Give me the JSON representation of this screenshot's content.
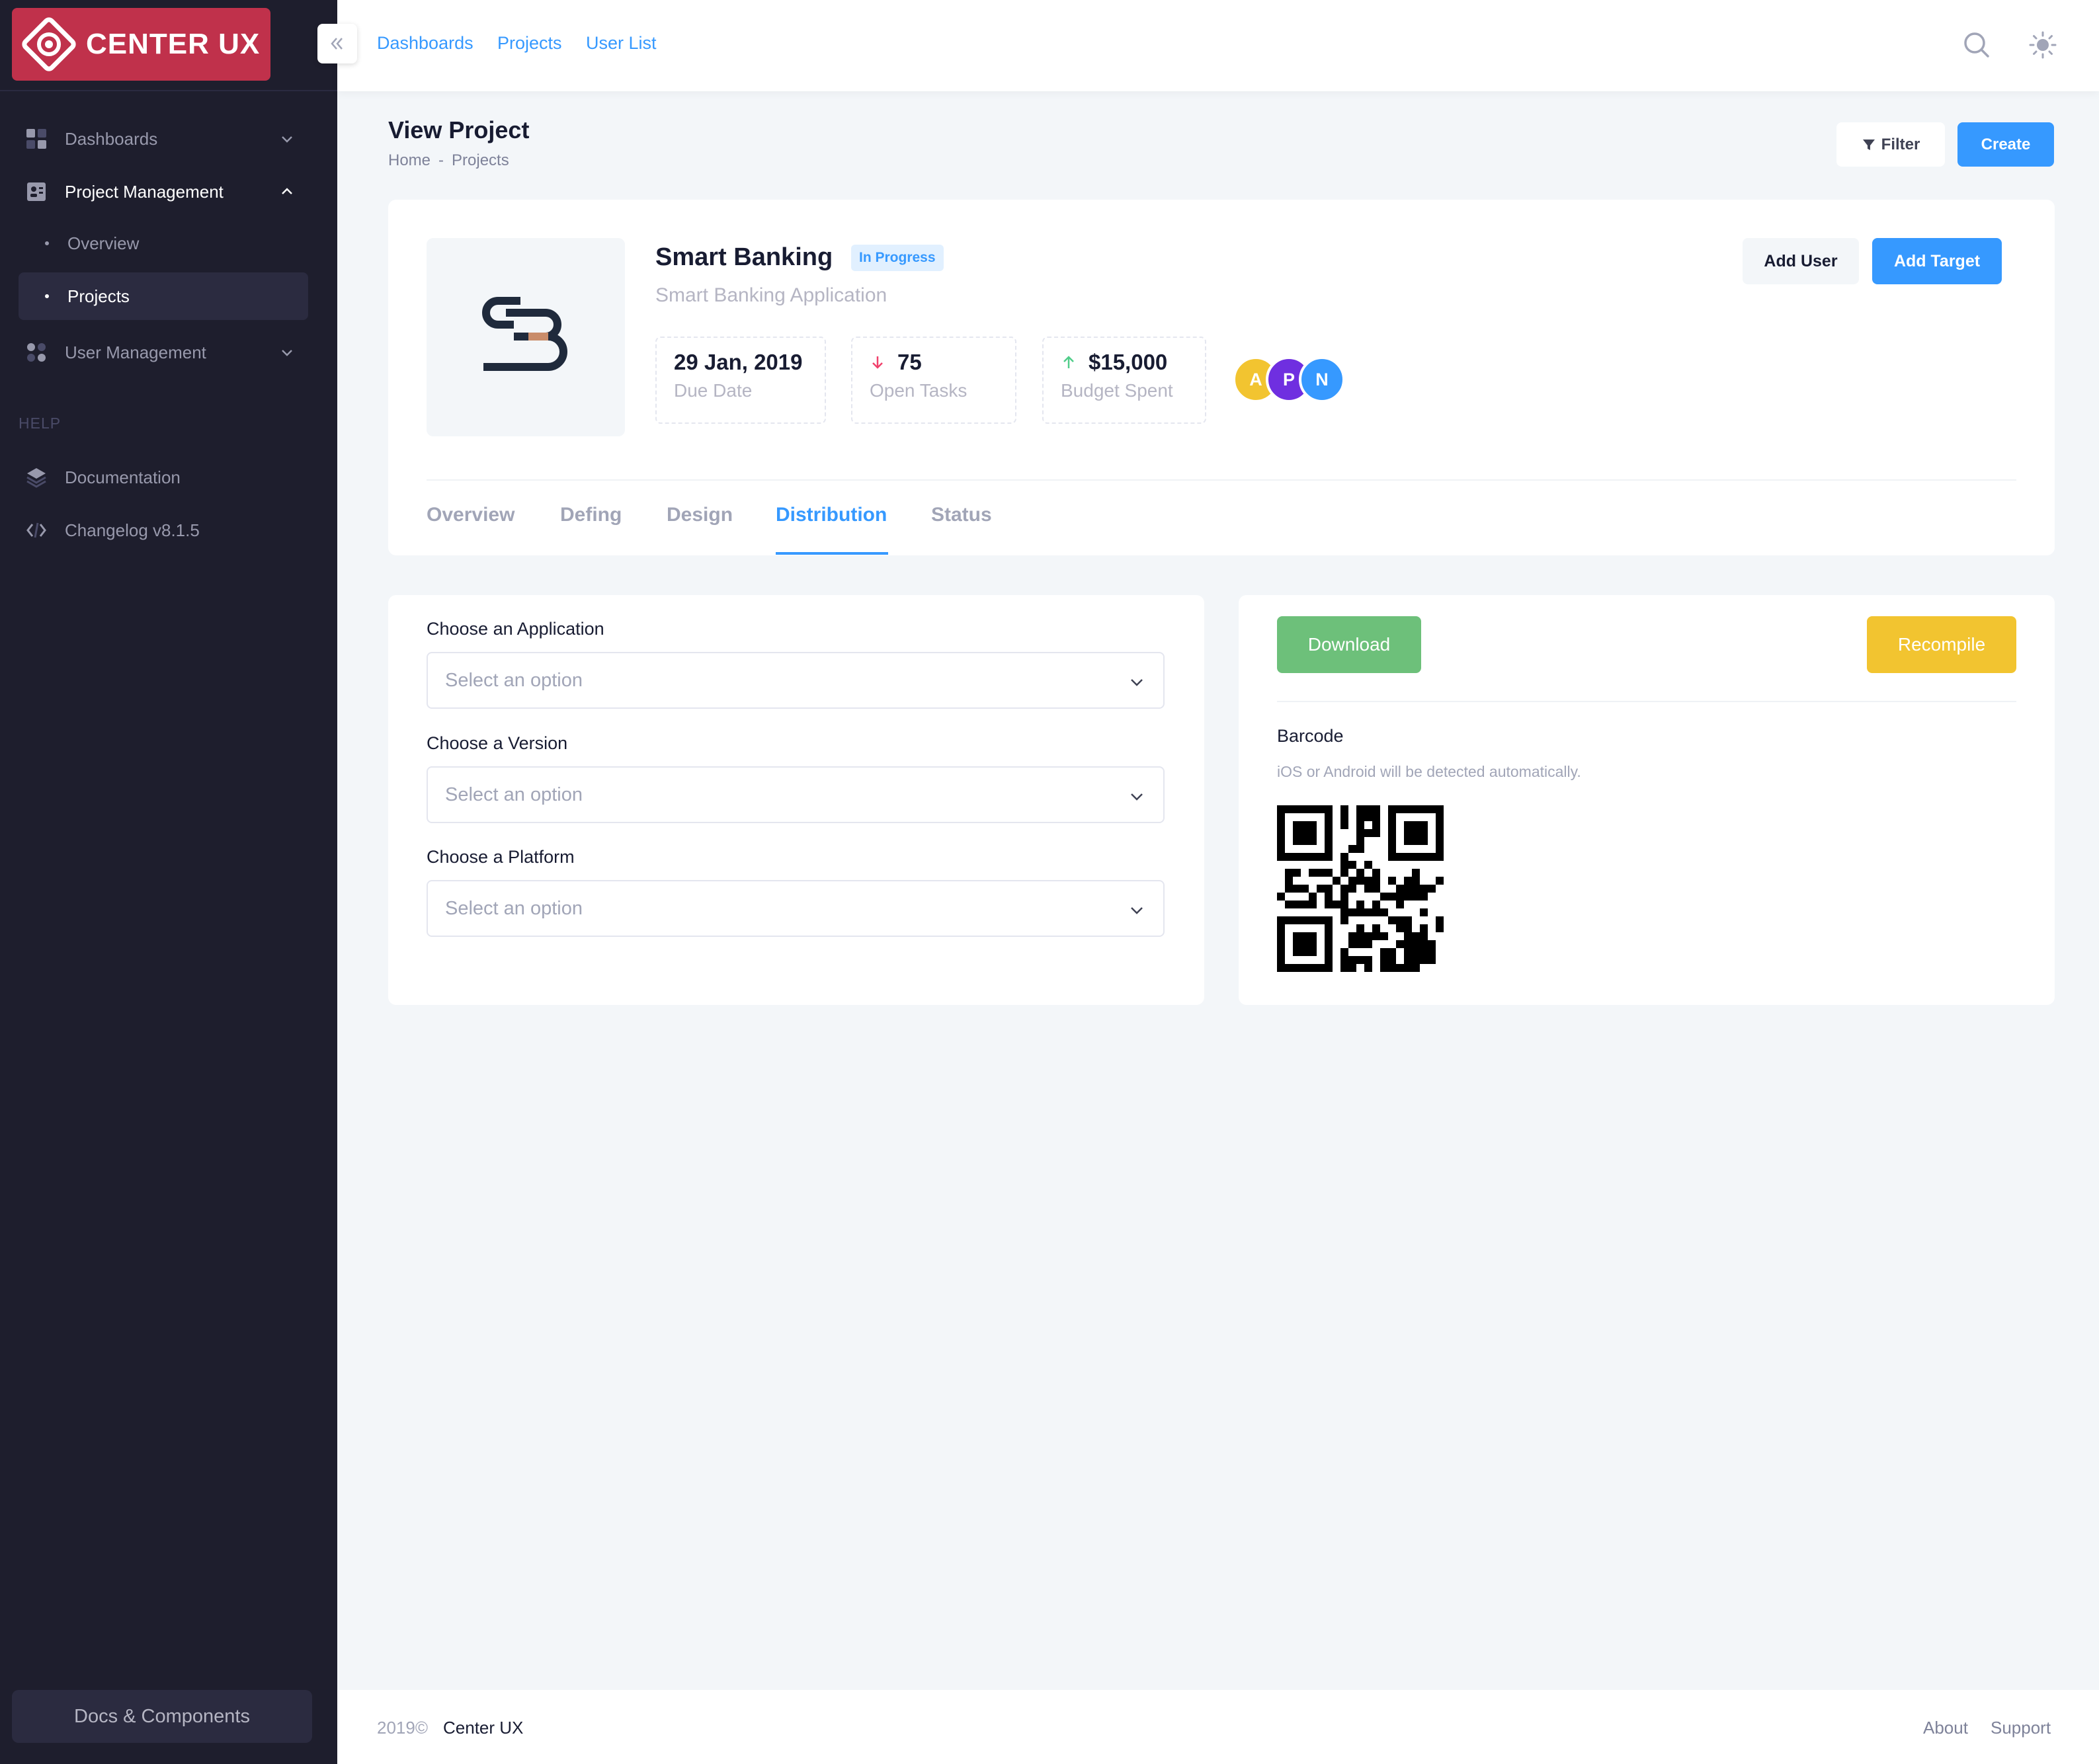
{
  "brand": {
    "name": "CENTER UX",
    "color": "#c0314b"
  },
  "sidebar": {
    "items": [
      {
        "label": "Dashboards",
        "icon": "dashboard-icon",
        "expanded": false
      },
      {
        "label": "Project Management",
        "icon": "project-icon",
        "expanded": true,
        "children": [
          {
            "label": "Overview",
            "active": false
          },
          {
            "label": "Projects",
            "active": true
          }
        ]
      },
      {
        "label": "User Management",
        "icon": "users-icon",
        "expanded": false
      }
    ],
    "help_label": "HELP",
    "help_items": [
      {
        "label": "Documentation",
        "icon": "layers-icon"
      },
      {
        "label": "Changelog v8.1.5",
        "icon": "code-icon"
      }
    ],
    "docs_button": "Docs & Components"
  },
  "header": {
    "links": [
      "Dashboards",
      "Projects",
      "User List"
    ]
  },
  "toolbar": {
    "title": "View Project",
    "breadcrumb": [
      "Home",
      "Projects"
    ],
    "filter_label": "Filter",
    "create_label": "Create"
  },
  "project": {
    "name": "Smart Banking",
    "status": "In Progress",
    "description": "Smart Banking Application",
    "stats": [
      {
        "value": "29 Jan, 2019",
        "label": "Due Date",
        "trend": "none"
      },
      {
        "value": "75",
        "label": "Open Tasks",
        "trend": "down"
      },
      {
        "value": "$15,000",
        "label": "Budget Spent",
        "trend": "up"
      }
    ],
    "members": [
      {
        "initial": "A",
        "color": "#f2c430"
      },
      {
        "initial": "P",
        "color": "#6f2fe0"
      },
      {
        "initial": "N",
        "color": "#3699ff"
      }
    ],
    "add_user_label": "Add User",
    "add_target_label": "Add Target",
    "tabs": [
      "Overview",
      "Defing",
      "Design",
      "Distribution",
      "Status"
    ],
    "active_tab": "Distribution"
  },
  "distribution": {
    "fields": [
      {
        "label": "Choose an Application",
        "placeholder": "Select an option"
      },
      {
        "label": "Choose a Version",
        "placeholder": "Select an option"
      },
      {
        "label": "Choose a Platform",
        "placeholder": "Select an option"
      }
    ],
    "download_label": "Download",
    "recompile_label": "Recompile",
    "barcode_title": "Barcode",
    "barcode_subtitle": "iOS or Android will be detected automatically."
  },
  "footer": {
    "year": "2019©",
    "brand": "Center UX",
    "links": [
      "About",
      "Support"
    ]
  }
}
